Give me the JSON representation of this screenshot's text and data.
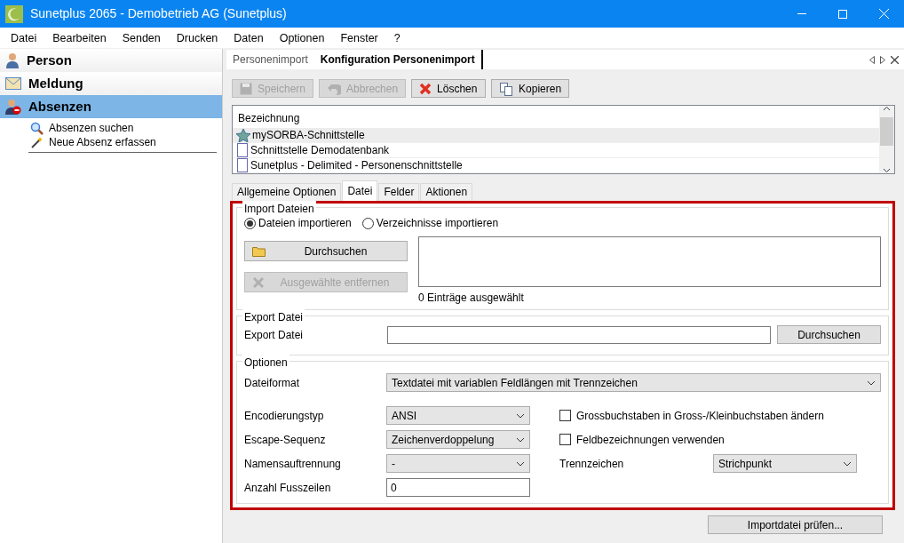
{
  "window": {
    "title": "Sunetplus 2065 - Demobetrieb AG (Sunetplus)"
  },
  "menu": [
    "Datei",
    "Bearbeiten",
    "Senden",
    "Drucken",
    "Daten",
    "Optionen",
    "Fenster",
    "?"
  ],
  "sidebar": {
    "sections": [
      {
        "label": "Person",
        "kind": "person",
        "selected": false
      },
      {
        "label": "Meldung",
        "kind": "mail",
        "selected": false
      },
      {
        "label": "Absenzen",
        "kind": "absence",
        "selected": true
      }
    ],
    "tasks": [
      {
        "label": "Absenzen suchen",
        "kind": "search"
      },
      {
        "label": "Neue Absenz erfassen",
        "kind": "wand"
      }
    ]
  },
  "doc_tabs": [
    {
      "label": "Personenimport",
      "selected": false
    },
    {
      "label": "Konfiguration Personenimport",
      "selected": true
    }
  ],
  "toolbar": [
    {
      "label": "Speichern",
      "kind": "save",
      "disabled": true
    },
    {
      "label": "Abbrechen",
      "kind": "undo",
      "disabled": true
    },
    {
      "label": "Löschen",
      "kind": "delete",
      "disabled": false
    },
    {
      "label": "Kopieren",
      "kind": "copy",
      "disabled": false
    }
  ],
  "config_list": {
    "header": "Bezeichnung",
    "items": [
      {
        "label": "mySORBA-Schnittstelle",
        "kind": "star",
        "selected": true
      },
      {
        "label": "Schnittstelle Demodatenbank",
        "kind": "doc",
        "selected": false
      },
      {
        "label": "Sunetplus - Delimited - Personenschnittstelle",
        "kind": "doc",
        "selected": false
      }
    ]
  },
  "inner_tabs": [
    {
      "label": "Allgemeine Optionen",
      "selected": false
    },
    {
      "label": "Datei",
      "selected": true
    },
    {
      "label": "Felder",
      "selected": false
    },
    {
      "label": "Aktionen",
      "selected": false
    }
  ],
  "import_group": {
    "title": "Import Dateien",
    "radios": [
      {
        "label": "Dateien importieren",
        "selected": true
      },
      {
        "label": "Verzeichnisse importieren",
        "selected": false
      }
    ],
    "browse_button": {
      "label": "Durchsuchen",
      "disabled": false
    },
    "remove_button": {
      "label": "Ausgewählte entfernen",
      "disabled": true
    },
    "count": "0 Einträge ausgewählt"
  },
  "export_group": {
    "title": "Export Datei",
    "label": "Export Datei",
    "browse_button": "Durchsuchen"
  },
  "options_group": {
    "title": "Optionen",
    "file_format": {
      "label": "Dateiformat",
      "value": "Textdatei mit variablen Feldlängen mit Trennzeichen"
    },
    "encoding": {
      "label": "Encodierungstyp",
      "value": "ANSI"
    },
    "escape": {
      "label": "Escape-Sequenz",
      "value": "Zeichenverdoppelung"
    },
    "name_split": {
      "label": "Namensauftrennung",
      "value": "-"
    },
    "footer_lines": {
      "label": "Anzahl Fusszeilen",
      "value": "0"
    },
    "checkboxes": [
      {
        "label": "Grossbuchstaben in Gross-/Kleinbuchstaben ändern",
        "checked": false
      },
      {
        "label": "Feldbezeichnungen verwenden",
        "checked": false
      }
    ],
    "separator": {
      "label": "Trennzeichen",
      "value": "Strichpunkt"
    }
  },
  "check_button": "Importdatei prüfen..."
}
